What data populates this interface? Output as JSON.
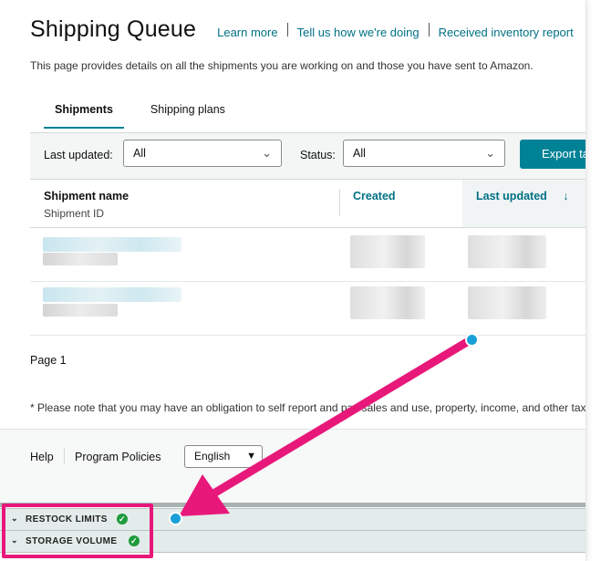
{
  "header": {
    "title": "Shipping Queue",
    "links": [
      "Learn more",
      "Tell us how we're doing",
      "Received inventory report"
    ],
    "description": "This page provides details on all the shipments you are working on and those you have sent to Amazon."
  },
  "tabs": [
    "Shipments",
    "Shipping plans"
  ],
  "filters": {
    "last_updated_label": "Last updated:",
    "last_updated_value": "All",
    "status_label": "Status:",
    "status_value": "All",
    "export_label": "Export table"
  },
  "table": {
    "columns": {
      "name": "Shipment name",
      "name_sub": "Shipment ID",
      "created": "Created",
      "last_updated": "Last updated",
      "sort_icon": "arrow-down-icon"
    },
    "row_count": 2
  },
  "pagination": "Page 1",
  "note": "* Please note that you may have an obligation to self report and pay sales and use, property, income, and other taxes.",
  "footer": {
    "help": "Help",
    "policies": "Program Policies",
    "language": "English"
  },
  "widgets": [
    {
      "label": "RESTOCK LIMITS",
      "status": "ok"
    },
    {
      "label": "STORAGE VOLUME",
      "status": "ok"
    }
  ],
  "colors": {
    "accent": "#008296",
    "link": "#007185",
    "annotation": "#e8187a",
    "annotation_dot": "#1aa0d8",
    "check": "#1e9b3c"
  }
}
